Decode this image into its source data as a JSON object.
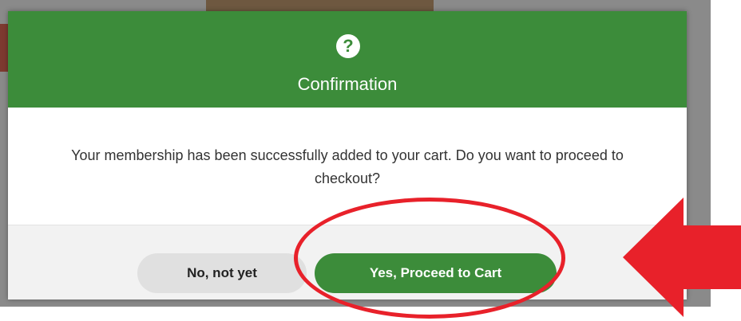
{
  "dialog": {
    "title": "Confirmation",
    "icon": "question-mark-icon",
    "message": "Your membership has been successfully added to your cart. Do you want to proceed to checkout?",
    "buttons": {
      "no_label": "No, not yet",
      "yes_label": "Yes, Proceed to Cart"
    }
  },
  "colors": {
    "header_green": "#3c8c3a",
    "primary_button_green": "#3c8c3a",
    "secondary_button_gray": "#e0e0e0",
    "annotation_red": "#e8212a"
  }
}
